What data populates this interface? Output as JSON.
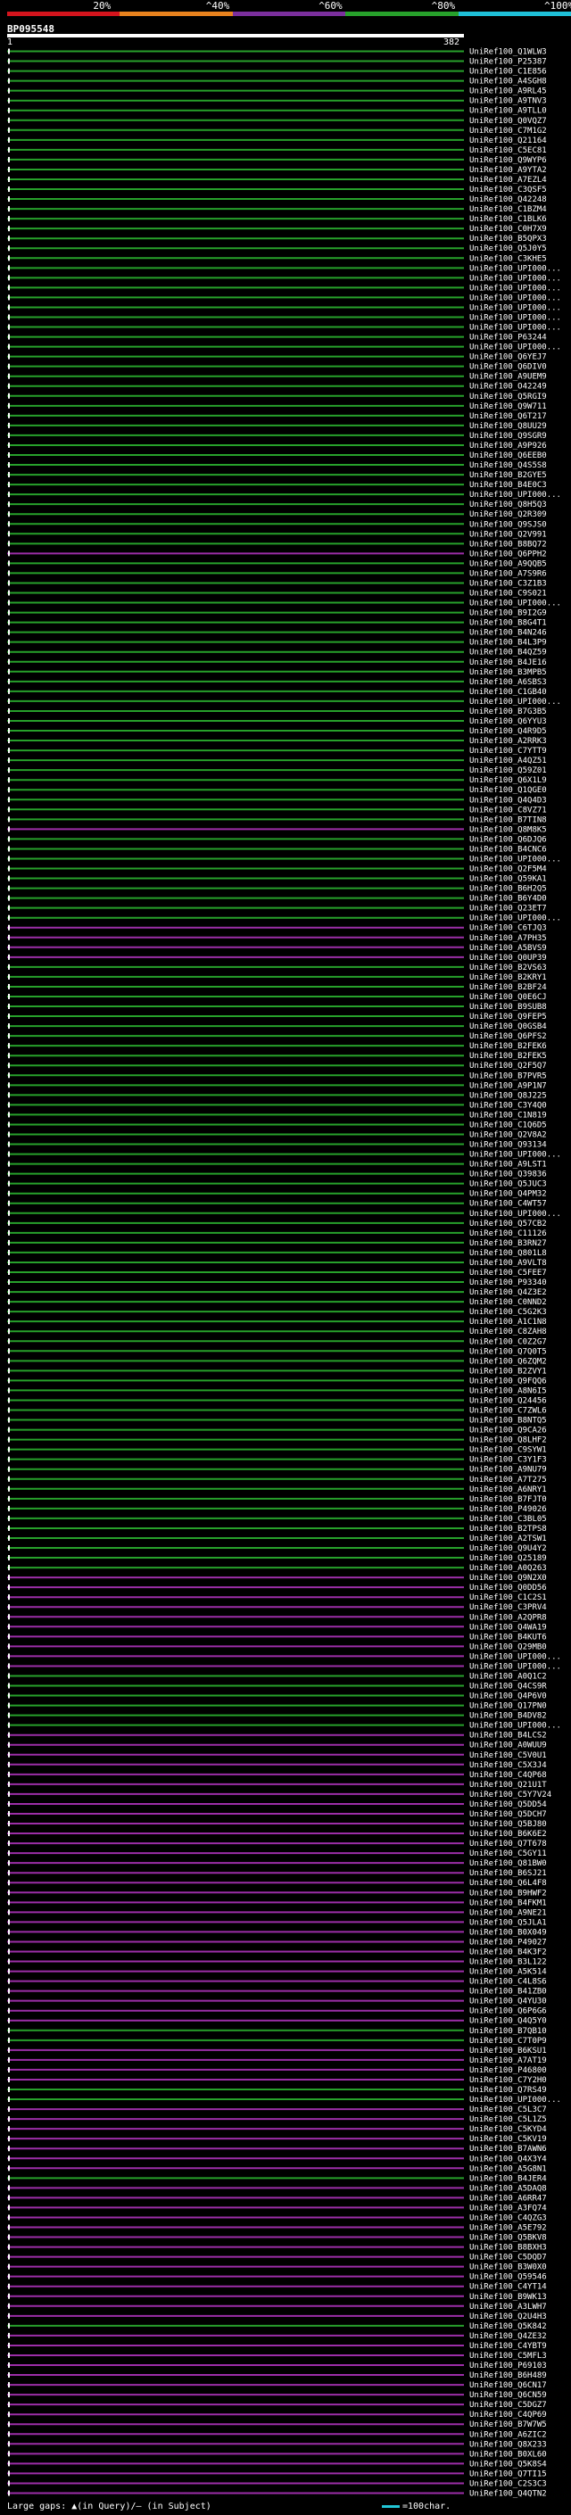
{
  "header": {
    "scale_labels": [
      "20%",
      "^40%",
      "^60%",
      "^80%",
      "^100%"
    ],
    "scale_colors": [
      "#d4141d",
      "#e8821e",
      "#7b2f9d",
      "#27a12b",
      "#1fc0d8"
    ],
    "query_name": "BP095548",
    "query_start": "1",
    "query_end": "382"
  },
  "colors": {
    "green": "#27a12b",
    "purple": "#9c2ea8",
    "cyan": "#22c6d6",
    "label": "#ffffff"
  },
  "footer": {
    "gaps_text": "Large gaps: ▲(in Query)/— (in Subject)",
    "scale_text": "=100char."
  },
  "chart_data": {
    "type": "alignment",
    "query_length": 382,
    "hits": [
      {
        "label": "UniRef100_Q1WLW3",
        "c": "g"
      },
      {
        "label": "UniRef100_P25387",
        "c": "g"
      },
      {
        "label": "UniRef100_C1E856",
        "c": "g"
      },
      {
        "label": "UniRef100_A4SGH8",
        "c": "g"
      },
      {
        "label": "UniRef100_A9RL45",
        "c": "g"
      },
      {
        "label": "UniRef100_A9TNV3",
        "c": "g"
      },
      {
        "label": "UniRef100_A9TLL0",
        "c": "g"
      },
      {
        "label": "UniRef100_Q0VQZ7",
        "c": "g"
      },
      {
        "label": "UniRef100_C7M1G2",
        "c": "g"
      },
      {
        "label": "UniRef100_Q21164",
        "c": "g"
      },
      {
        "label": "UniRef100_C5EC81",
        "c": "g"
      },
      {
        "label": "UniRef100_Q9WYP6",
        "c": "g"
      },
      {
        "label": "UniRef100_A9YTA2",
        "c": "g"
      },
      {
        "label": "UniRef100_A7EZL4",
        "c": "g"
      },
      {
        "label": "UniRef100_C3QSF5",
        "c": "g"
      },
      {
        "label": "UniRef100_Q42248",
        "c": "g"
      },
      {
        "label": "UniRef100_C1BZM4",
        "c": "g"
      },
      {
        "label": "UniRef100_C1BLK6",
        "c": "g"
      },
      {
        "label": "UniRef100_C0H7X9",
        "c": "g"
      },
      {
        "label": "UniRef100_B5QPX3",
        "c": "g"
      },
      {
        "label": "UniRef100_Q5J0Y5",
        "c": "g"
      },
      {
        "label": "UniRef100_C3KHE5",
        "c": "g"
      },
      {
        "label": "UniRef100_UPI000...",
        "c": "g"
      },
      {
        "label": "UniRef100_UPI000...",
        "c": "g"
      },
      {
        "label": "UniRef100_UPI000...",
        "c": "g"
      },
      {
        "label": "UniRef100_UPI000...",
        "c": "g"
      },
      {
        "label": "UniRef100_UPI000...",
        "c": "g"
      },
      {
        "label": "UniRef100_UPI000...",
        "c": "g"
      },
      {
        "label": "UniRef100_UPI000...",
        "c": "g"
      },
      {
        "label": "UniRef100_P63244",
        "c": "g"
      },
      {
        "label": "UniRef100_UPI000...",
        "c": "g"
      },
      {
        "label": "UniRef100_Q6YEJ7",
        "c": "g"
      },
      {
        "label": "UniRef100_Q6DIV0",
        "c": "g"
      },
      {
        "label": "UniRef100_A9UEM9",
        "c": "g"
      },
      {
        "label": "UniRef100_O42249",
        "c": "g"
      },
      {
        "label": "UniRef100_Q5RGI9",
        "c": "g"
      },
      {
        "label": "UniRef100_Q9W711",
        "c": "g"
      },
      {
        "label": "UniRef100_Q6T217",
        "c": "g"
      },
      {
        "label": "UniRef100_Q8UU29",
        "c": "g"
      },
      {
        "label": "UniRef100_Q9SGR9",
        "c": "g"
      },
      {
        "label": "UniRef100_A9P926",
        "c": "g"
      },
      {
        "label": "UniRef100_Q6EEB0",
        "c": "g"
      },
      {
        "label": "UniRef100_Q4S5S8",
        "c": "g"
      },
      {
        "label": "UniRef100_B2GYE5",
        "c": "g"
      },
      {
        "label": "UniRef100_B4E0C3",
        "c": "g"
      },
      {
        "label": "UniRef100_UPI000...",
        "c": "g"
      },
      {
        "label": "UniRef100_Q8H5Q3",
        "c": "g"
      },
      {
        "label": "UniRef100_Q2R309",
        "c": "g"
      },
      {
        "label": "UniRef100_Q9SJS0",
        "c": "g"
      },
      {
        "label": "UniRef100_Q2V991",
        "c": "g"
      },
      {
        "label": "UniRef100_B8BQ72",
        "c": "g"
      },
      {
        "label": "UniRef100_Q6PPH2",
        "c": "p"
      },
      {
        "label": "UniRef100_A9QQB5",
        "c": "g"
      },
      {
        "label": "UniRef100_A7S9R6",
        "c": "g"
      },
      {
        "label": "UniRef100_C3Z1B3",
        "c": "g"
      },
      {
        "label": "UniRef100_C9S021",
        "c": "g"
      },
      {
        "label": "UniRef100_UPI000...",
        "c": "g"
      },
      {
        "label": "UniRef100_B9I2G9",
        "c": "g"
      },
      {
        "label": "UniRef100_B8G4T1",
        "c": "g"
      },
      {
        "label": "UniRef100_B4N246",
        "c": "g"
      },
      {
        "label": "UniRef100_B4L3P9",
        "c": "g"
      },
      {
        "label": "UniRef100_B4QZ59",
        "c": "g"
      },
      {
        "label": "UniRef100_B4JE16",
        "c": "g"
      },
      {
        "label": "UniRef100_B3MPB5",
        "c": "g"
      },
      {
        "label": "UniRef100_A6SBS3",
        "c": "g"
      },
      {
        "label": "UniRef100_C1GB40",
        "c": "g"
      },
      {
        "label": "UniRef100_UPI000...",
        "c": "g"
      },
      {
        "label": "UniRef100_B7G3B5",
        "c": "g"
      },
      {
        "label": "UniRef100_Q6YYU3",
        "c": "g"
      },
      {
        "label": "UniRef100_Q4R9D5",
        "c": "g"
      },
      {
        "label": "UniRef100_A2RRK3",
        "c": "g"
      },
      {
        "label": "UniRef100_C7YTT9",
        "c": "g"
      },
      {
        "label": "UniRef100_A4QZ51",
        "c": "g"
      },
      {
        "label": "UniRef100_Q59Z01",
        "c": "g"
      },
      {
        "label": "UniRef100_Q6X1L9",
        "c": "g"
      },
      {
        "label": "UniRef100_Q1QGE0",
        "c": "g"
      },
      {
        "label": "UniRef100_Q4Q4D3",
        "c": "g"
      },
      {
        "label": "UniRef100_C8VZ71",
        "c": "g"
      },
      {
        "label": "UniRef100_B7TIN8",
        "c": "g"
      },
      {
        "label": "UniRef100_Q8M8K5",
        "c": "p"
      },
      {
        "label": "UniRef100_Q6DJQ6",
        "c": "g"
      },
      {
        "label": "UniRef100_B4CNC6",
        "c": "g"
      },
      {
        "label": "UniRef100_UPI000...",
        "c": "g"
      },
      {
        "label": "UniRef100_Q2F5M4",
        "c": "g"
      },
      {
        "label": "UniRef100_Q59KA1",
        "c": "g"
      },
      {
        "label": "UniRef100_B6H2Q5",
        "c": "g"
      },
      {
        "label": "UniRef100_B6Y4D0",
        "c": "g"
      },
      {
        "label": "UniRef100_Q23ET7",
        "c": "g"
      },
      {
        "label": "UniRef100_UPI000...",
        "c": "g"
      },
      {
        "label": "UniRef100_C6TJQ3",
        "c": "p"
      },
      {
        "label": "UniRef100_A7PH35",
        "c": "p"
      },
      {
        "label": "UniRef100_A5BVS9",
        "c": "p"
      },
      {
        "label": "UniRef100_Q0UP39",
        "c": "p"
      },
      {
        "label": "UniRef100_B2VS63",
        "c": "g"
      },
      {
        "label": "UniRef100_B2KRY1",
        "c": "g"
      },
      {
        "label": "UniRef100_B2BF24",
        "c": "g"
      },
      {
        "label": "UniRef100_Q0E6CJ",
        "c": "g"
      },
      {
        "label": "UniRef100_B9SUB8",
        "c": "g"
      },
      {
        "label": "UniRef100_Q9FEP5",
        "c": "g"
      },
      {
        "label": "UniRef100_Q0GSB4",
        "c": "g"
      },
      {
        "label": "UniRef100_Q6PFS2",
        "c": "g"
      },
      {
        "label": "UniRef100_B2FEK6",
        "c": "g"
      },
      {
        "label": "UniRef100_B2FEK5",
        "c": "g"
      },
      {
        "label": "UniRef100_Q2F5Q7",
        "c": "g"
      },
      {
        "label": "UniRef100_B7PVR5",
        "c": "g"
      },
      {
        "label": "UniRef100_A9P1N7",
        "c": "g"
      },
      {
        "label": "UniRef100_Q8J225",
        "c": "g"
      },
      {
        "label": "UniRef100_C3Y4Q0",
        "c": "g"
      },
      {
        "label": "UniRef100_C1N819",
        "c": "g"
      },
      {
        "label": "UniRef100_C1Q6D5",
        "c": "g"
      },
      {
        "label": "UniRef100_Q2V8A2",
        "c": "g"
      },
      {
        "label": "UniRef100_Q93134",
        "c": "g"
      },
      {
        "label": "UniRef100_UPI000...",
        "c": "g"
      },
      {
        "label": "UniRef100_A9LST1",
        "c": "g"
      },
      {
        "label": "UniRef100_Q39836",
        "c": "g"
      },
      {
        "label": "UniRef100_Q5JUC3",
        "c": "g"
      },
      {
        "label": "UniRef100_Q4PM32",
        "c": "g"
      },
      {
        "label": "UniRef100_C4WT57",
        "c": "g"
      },
      {
        "label": "UniRef100_UPI000...",
        "c": "g"
      },
      {
        "label": "UniRef100_Q57CB2",
        "c": "g"
      },
      {
        "label": "UniRef100_C11126",
        "c": "g"
      },
      {
        "label": "UniRef100_B3RN27",
        "c": "g"
      },
      {
        "label": "UniRef100_Q801L8",
        "c": "g"
      },
      {
        "label": "UniRef100_A9VLT8",
        "c": "g"
      },
      {
        "label": "UniRef100_C5FEE7",
        "c": "g"
      },
      {
        "label": "UniRef100_P93340",
        "c": "g"
      },
      {
        "label": "UniRef100_Q4Z3E2",
        "c": "g"
      },
      {
        "label": "UniRef100_C0NND2",
        "c": "g"
      },
      {
        "label": "UniRef100_C5G2K3",
        "c": "g"
      },
      {
        "label": "UniRef100_A1C1N8",
        "c": "g"
      },
      {
        "label": "UniRef100_C8ZAH8",
        "c": "g"
      },
      {
        "label": "UniRef100_C0Z2G7",
        "c": "g"
      },
      {
        "label": "UniRef100_Q7Q0T5",
        "c": "g"
      },
      {
        "label": "UniRef100_Q6ZQM2",
        "c": "g"
      },
      {
        "label": "UniRef100_B2ZVY1",
        "c": "g"
      },
      {
        "label": "UniRef100_Q9FQQ6",
        "c": "g"
      },
      {
        "label": "UniRef100_A8N6I5",
        "c": "g"
      },
      {
        "label": "UniRef100_Q24456",
        "c": "g"
      },
      {
        "label": "UniRef100_C7ZWL6",
        "c": "g"
      },
      {
        "label": "UniRef100_B8NTQ5",
        "c": "g"
      },
      {
        "label": "UniRef100_Q9CA26",
        "c": "g"
      },
      {
        "label": "UniRef100_Q8LHF2",
        "c": "g"
      },
      {
        "label": "UniRef100_C9SYW1",
        "c": "g"
      },
      {
        "label": "UniRef100_C3Y1F3",
        "c": "g"
      },
      {
        "label": "UniRef100_A9NU79",
        "c": "g"
      },
      {
        "label": "UniRef100_A7T275",
        "c": "g"
      },
      {
        "label": "UniRef100_A6NRY1",
        "c": "g"
      },
      {
        "label": "UniRef100_B7FJT0",
        "c": "g"
      },
      {
        "label": "UniRef100_P49026",
        "c": "g"
      },
      {
        "label": "UniRef100_C3BL05",
        "c": "g"
      },
      {
        "label": "UniRef100_B2TPS8",
        "c": "g"
      },
      {
        "label": "UniRef100_A2TSW1",
        "c": "g"
      },
      {
        "label": "UniRef100_Q9U4Y2",
        "c": "g"
      },
      {
        "label": "UniRef100_Q25189",
        "c": "g"
      },
      {
        "label": "UniRef100_A0Q263",
        "c": "g"
      },
      {
        "label": "UniRef100_Q9N2X0",
        "c": "p"
      },
      {
        "label": "UniRef100_Q0DD56",
        "c": "p"
      },
      {
        "label": "UniRef100_C1C2S1",
        "c": "p"
      },
      {
        "label": "UniRef100_C3PRV4",
        "c": "p"
      },
      {
        "label": "UniRef100_A2QPR8",
        "c": "p"
      },
      {
        "label": "UniRef100_Q4WA19",
        "c": "p"
      },
      {
        "label": "UniRef100_B4KUT6",
        "c": "p"
      },
      {
        "label": "UniRef100_Q29MB0",
        "c": "p"
      },
      {
        "label": "UniRef100_UPI000...",
        "c": "p"
      },
      {
        "label": "UniRef100_UPI000...",
        "c": "p"
      },
      {
        "label": "UniRef100_A0Q1C2",
        "c": "g"
      },
      {
        "label": "UniRef100_Q4CS9R",
        "c": "g"
      },
      {
        "label": "UniRef100_Q4P6V0",
        "c": "g"
      },
      {
        "label": "UniRef100_Q17PN0",
        "c": "g"
      },
      {
        "label": "UniRef100_B4DV82",
        "c": "g"
      },
      {
        "label": "UniRef100_UPI000...",
        "c": "g"
      },
      {
        "label": "UniRef100_B4LCS2",
        "c": "p"
      },
      {
        "label": "UniRef100_A0WUU9",
        "c": "p"
      },
      {
        "label": "UniRef100_C5V0U1",
        "c": "p"
      },
      {
        "label": "UniRef100_C5X3J4",
        "c": "p"
      },
      {
        "label": "UniRef100_C4QP68",
        "c": "p"
      },
      {
        "label": "UniRef100_Q21U1T",
        "c": "p"
      },
      {
        "label": "UniRef100_C5Y7V24",
        "c": "p"
      },
      {
        "label": "UniRef100_Q5DD54",
        "c": "p"
      },
      {
        "label": "UniRef100_Q5DCH7",
        "c": "p"
      },
      {
        "label": "UniRef100_Q5BJ80",
        "c": "p"
      },
      {
        "label": "UniRef100_B6K6E2",
        "c": "p"
      },
      {
        "label": "UniRef100_Q7T678",
        "c": "p"
      },
      {
        "label": "UniRef100_C5GY11",
        "c": "p"
      },
      {
        "label": "UniRef100_Q81BW0",
        "c": "p"
      },
      {
        "label": "UniRef100_B6SJ21",
        "c": "p"
      },
      {
        "label": "UniRef100_Q6L4F8",
        "c": "p"
      },
      {
        "label": "UniRef100_B9HWF2",
        "c": "p"
      },
      {
        "label": "UniRef100_B4FKM1",
        "c": "p"
      },
      {
        "label": "UniRef100_A9NE21",
        "c": "p"
      },
      {
        "label": "UniRef100_Q5JLA1",
        "c": "p"
      },
      {
        "label": "UniRef100_B0X049",
        "c": "p"
      },
      {
        "label": "UniRef100_P49027",
        "c": "p"
      },
      {
        "label": "UniRef100_B4K3F2",
        "c": "p"
      },
      {
        "label": "UniRef100_B3L122",
        "c": "p"
      },
      {
        "label": "UniRef100_A5K514",
        "c": "p"
      },
      {
        "label": "UniRef100_C4L8S6",
        "c": "p"
      },
      {
        "label": "UniRef100_B41ZB0",
        "c": "p"
      },
      {
        "label": "UniRef100_Q4YU30",
        "c": "p"
      },
      {
        "label": "UniRef100_Q6P6G6",
        "c": "p"
      },
      {
        "label": "UniRef100_Q4Q5Y0",
        "c": "p"
      },
      {
        "label": "UniRef100_B7QB10",
        "c": "g"
      },
      {
        "label": "UniRef100_C7T0P9",
        "c": "g"
      },
      {
        "label": "UniRef100_B6KSU1",
        "c": "p"
      },
      {
        "label": "UniRef100_A7AT19",
        "c": "p"
      },
      {
        "label": "UniRef100_P46800",
        "c": "p"
      },
      {
        "label": "UniRef100_C7Y2H0",
        "c": "p"
      },
      {
        "label": "UniRef100_Q7RS49",
        "c": "g"
      },
      {
        "label": "UniRef100_UPI000...",
        "c": "g"
      },
      {
        "label": "UniRef100_C5L3C7",
        "c": "p"
      },
      {
        "label": "UniRef100_C5L1Z5",
        "c": "p"
      },
      {
        "label": "UniRef100_C5KYD4",
        "c": "p"
      },
      {
        "label": "UniRef100_C5KV19",
        "c": "p"
      },
      {
        "label": "UniRef100_B7AWN6",
        "c": "p"
      },
      {
        "label": "UniRef100_Q4X3Y4",
        "c": "p"
      },
      {
        "label": "UniRef100_A5G8N1",
        "c": "p"
      },
      {
        "label": "UniRef100_B4JER4",
        "c": "g"
      },
      {
        "label": "UniRef100_A5DAQ8",
        "c": "p"
      },
      {
        "label": "UniRef100_A6RR47",
        "c": "p"
      },
      {
        "label": "UniRef100_A3FQ74",
        "c": "p"
      },
      {
        "label": "UniRef100_C4QZG3",
        "c": "p"
      },
      {
        "label": "UniRef100_A5E792",
        "c": "p"
      },
      {
        "label": "UniRef100_Q5BKV8",
        "c": "p"
      },
      {
        "label": "UniRef100_B8BXH3",
        "c": "p"
      },
      {
        "label": "UniRef100_C5DQD7",
        "c": "p"
      },
      {
        "label": "UniRef100_B3W0X0",
        "c": "p"
      },
      {
        "label": "UniRef100_Q59546",
        "c": "p"
      },
      {
        "label": "UniRef100_C4YT14",
        "c": "p"
      },
      {
        "label": "UniRef100_B9WK13",
        "c": "p"
      },
      {
        "label": "UniRef100_A3LWH7",
        "c": "p"
      },
      {
        "label": "UniRef100_Q2U4H3",
        "c": "p"
      },
      {
        "label": "UniRef100_Q5K842",
        "c": "g"
      },
      {
        "label": "UniRef100_Q4ZE32",
        "c": "p"
      },
      {
        "label": "UniRef100_C4YBT9",
        "c": "p"
      },
      {
        "label": "UniRef100_C5MFL3",
        "c": "p"
      },
      {
        "label": "UniRef100_P69103",
        "c": "p"
      },
      {
        "label": "UniRef100_B6H489",
        "c": "p"
      },
      {
        "label": "UniRef100_Q6CN17",
        "c": "p"
      },
      {
        "label": "UniRef100_Q6CN59",
        "c": "p"
      },
      {
        "label": "UniRef100_C5DGZ7",
        "c": "p"
      },
      {
        "label": "UniRef100_C4QP69",
        "c": "p"
      },
      {
        "label": "UniRef100_B7W7W5",
        "c": "p"
      },
      {
        "label": "UniRef100_A6ZIC2",
        "c": "p"
      },
      {
        "label": "UniRef100_Q8X233",
        "c": "p"
      },
      {
        "label": "UniRef100_B0XL60",
        "c": "p"
      },
      {
        "label": "UniRef100_Q5K8S4",
        "c": "p"
      },
      {
        "label": "UniRef100_Q7TI15",
        "c": "p"
      },
      {
        "label": "UniRef100_C2S3C3",
        "c": "p"
      },
      {
        "label": "UniRef100_Q4QTN2",
        "c": "p"
      }
    ]
  }
}
